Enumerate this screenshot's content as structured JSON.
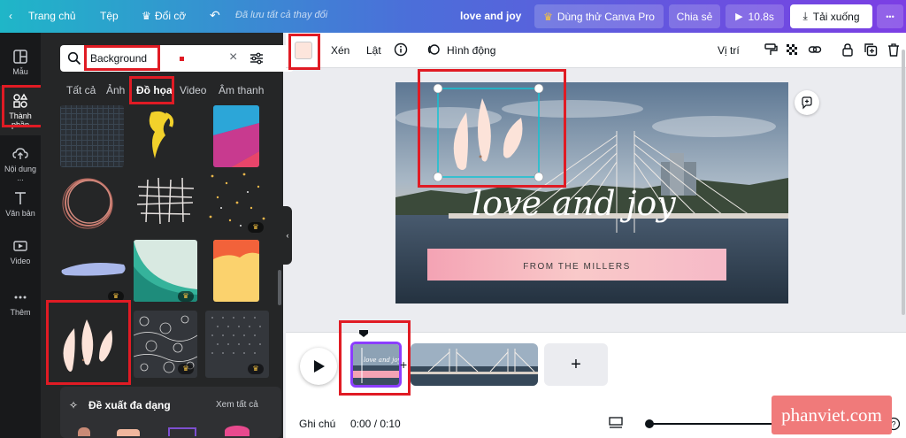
{
  "topbar": {
    "home": "Trang chủ",
    "file": "Tệp",
    "resize": "Đổi cỡ",
    "saved": "Đã lưu tất cả thay đổi",
    "title": "love and joy",
    "pro": "Dùng thử Canva Pro",
    "share": "Chia sẻ",
    "duration": "10.8s",
    "download": "Tải xuống",
    "more": "•••"
  },
  "rail": {
    "items": [
      {
        "label": "Mẫu"
      },
      {
        "label": "Thành phần"
      },
      {
        "label": "Nội dung ..."
      },
      {
        "label": "Văn bản"
      },
      {
        "label": "Video"
      },
      {
        "label": "Thêm"
      }
    ]
  },
  "search": {
    "value": "Background",
    "placeholder": ""
  },
  "categories": [
    "Tất cả",
    "Ảnh",
    "Đồ họa",
    "Video",
    "Âm thanh"
  ],
  "suggest": {
    "title": "Đề xuất đa dạng",
    "see_all": "Xem tất cả"
  },
  "editor_toolbar": {
    "crop": "Xén",
    "flip": "Lật",
    "animate": "Hình động",
    "position": "Vị trí",
    "swatch_color": "#fde5dc"
  },
  "canvas": {
    "script_text": "love and joy",
    "banner_text": "FROM THE MILLERS"
  },
  "timeline": {
    "notes": "Ghi chú",
    "time": "0:00 / 0:10",
    "thumb_text": "love and joy"
  },
  "watermark": "phanviet.com",
  "colors": {
    "highlight": "#e01b24",
    "petal": "#fce3d9",
    "selection": "#12c3d3"
  }
}
